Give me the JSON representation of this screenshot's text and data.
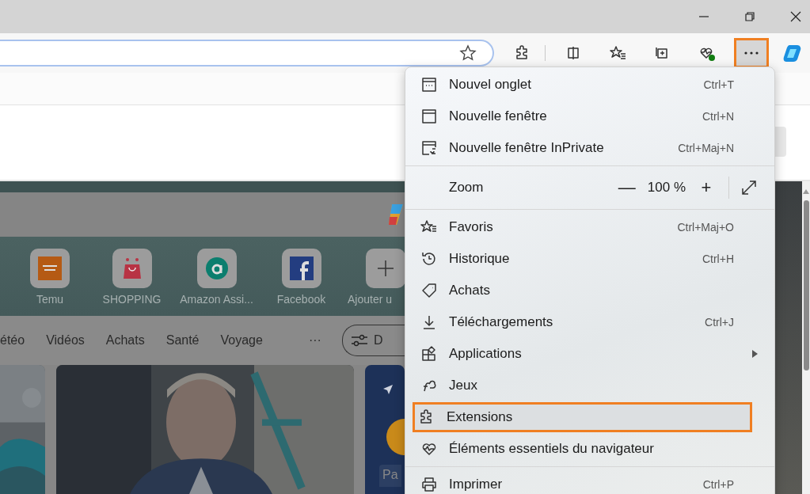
{
  "toolbar_buttons": [
    {
      "selected": false
    },
    {
      "selected": false
    },
    {
      "selected": false
    },
    {
      "selected": false
    },
    {
      "selected": false
    },
    {
      "selected": true
    },
    {
      "selected": false
    }
  ],
  "new_tab_page": {
    "quick_links": [
      {
        "label": "Temu"
      },
      {
        "label": "SHOPPING"
      },
      {
        "label": "Amazon Assi..."
      },
      {
        "label": "Facebook"
      },
      {
        "label": "Ajouter u"
      }
    ],
    "nav": [
      {
        "label": "étéo"
      },
      {
        "label": "Vidéos"
      },
      {
        "label": "Achats"
      },
      {
        "label": "Santé"
      },
      {
        "label": "Voyage"
      },
      {
        "label": "···"
      }
    ],
    "filter_button": {
      "label": "D"
    },
    "weather_card": {
      "text": "Pa"
    }
  },
  "menu": {
    "items": [
      {
        "kind": "item",
        "label": "Nouvel onglet",
        "shortcut": "Ctrl+T",
        "selected": false
      },
      {
        "kind": "item",
        "label": "Nouvelle fenêtre",
        "shortcut": "Ctrl+N",
        "selected": false
      },
      {
        "kind": "item",
        "label": "Nouvelle fenêtre InPrivate",
        "shortcut": "Ctrl+Maj+N",
        "selected": false
      },
      {
        "kind": "divider"
      },
      {
        "kind": "zoom",
        "label": "Zoom",
        "minus": "—",
        "value": "100 %",
        "plus": "+"
      },
      {
        "kind": "divider"
      },
      {
        "kind": "item",
        "label": "Favoris",
        "shortcut": "Ctrl+Maj+O",
        "selected": false
      },
      {
        "kind": "item",
        "label": "Historique",
        "shortcut": "Ctrl+H",
        "selected": false
      },
      {
        "kind": "item",
        "label": "Achats",
        "selected": false
      },
      {
        "kind": "item",
        "label": "Téléchargements",
        "shortcut": "Ctrl+J",
        "selected": false
      },
      {
        "kind": "submenu",
        "label": "Applications",
        "selected": false
      },
      {
        "kind": "item",
        "label": "Jeux",
        "selected": false
      },
      {
        "kind": "item",
        "label": "Extensions",
        "selected": true
      },
      {
        "kind": "item",
        "label": "Éléments essentiels du navigateur",
        "selected": false
      },
      {
        "kind": "divider"
      },
      {
        "kind": "item",
        "label": "Imprimer",
        "shortcut": "Ctrl+P",
        "selected": false
      }
    ]
  }
}
